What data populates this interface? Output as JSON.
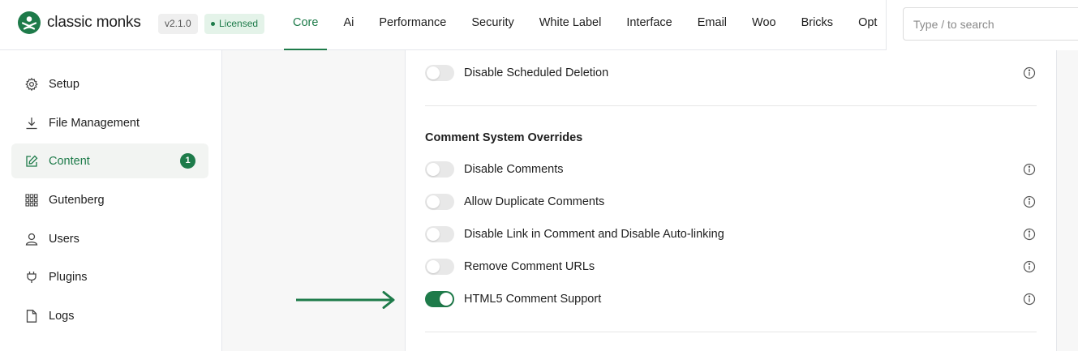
{
  "brand": {
    "name": "classic monks",
    "version": "v2.1.0",
    "license": "Licensed"
  },
  "nav": {
    "tabs": [
      {
        "label": "Core"
      },
      {
        "label": "Ai"
      },
      {
        "label": "Performance"
      },
      {
        "label": "Security"
      },
      {
        "label": "White Label"
      },
      {
        "label": "Interface"
      },
      {
        "label": "Email"
      },
      {
        "label": "Woo"
      },
      {
        "label": "Bricks"
      },
      {
        "label": "Opt"
      }
    ],
    "active": "Core"
  },
  "search": {
    "placeholder": "Type / to search"
  },
  "sidebar": {
    "items": [
      {
        "label": "Setup",
        "icon": "gear-icon"
      },
      {
        "label": "File Management",
        "icon": "download-icon"
      },
      {
        "label": "Content",
        "icon": "edit-icon",
        "badge": "1",
        "active": true
      },
      {
        "label": "Gutenberg",
        "icon": "grid-icon"
      },
      {
        "label": "Users",
        "icon": "user-icon"
      },
      {
        "label": "Plugins",
        "icon": "plug-icon"
      },
      {
        "label": "Logs",
        "icon": "file-icon"
      }
    ]
  },
  "settings": {
    "top": {
      "label": "Disable Scheduled Deletion",
      "enabled": false
    },
    "comment_section": {
      "title": "Comment System Overrides",
      "items": [
        {
          "label": "Disable Comments",
          "enabled": false
        },
        {
          "label": "Allow Duplicate Comments",
          "enabled": false
        },
        {
          "label": "Disable Link in Comment and Disable Auto-linking",
          "enabled": false
        },
        {
          "label": "Remove Comment URLs",
          "enabled": false
        },
        {
          "label": "HTML5 Comment Support",
          "enabled": true
        }
      ]
    }
  },
  "colors": {
    "accent": "#1e7b4a",
    "badge_bg": "#e4f3e9"
  }
}
